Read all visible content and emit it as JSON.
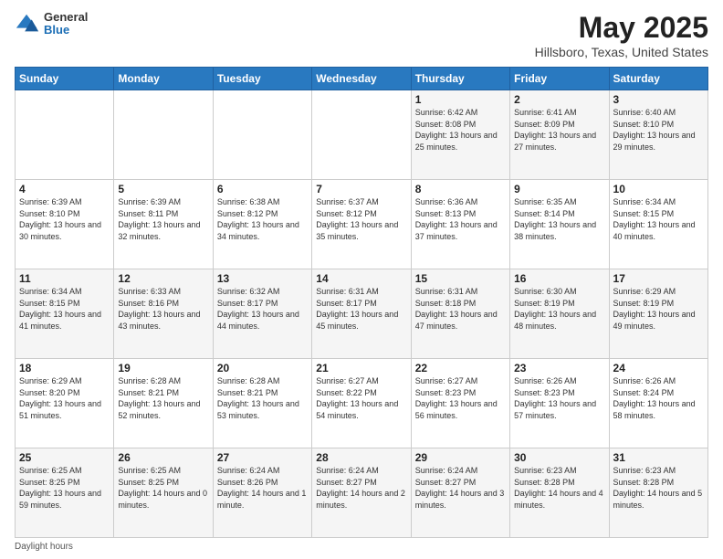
{
  "logo": {
    "general": "General",
    "blue": "Blue"
  },
  "header": {
    "title": "May 2025",
    "subtitle": "Hillsboro, Texas, United States"
  },
  "weekdays": [
    "Sunday",
    "Monday",
    "Tuesday",
    "Wednesday",
    "Thursday",
    "Friday",
    "Saturday"
  ],
  "weeks": [
    [
      {
        "day": "",
        "info": ""
      },
      {
        "day": "",
        "info": ""
      },
      {
        "day": "",
        "info": ""
      },
      {
        "day": "",
        "info": ""
      },
      {
        "day": "1",
        "info": "Sunrise: 6:42 AM\nSunset: 8:08 PM\nDaylight: 13 hours and 25 minutes."
      },
      {
        "day": "2",
        "info": "Sunrise: 6:41 AM\nSunset: 8:09 PM\nDaylight: 13 hours and 27 minutes."
      },
      {
        "day": "3",
        "info": "Sunrise: 6:40 AM\nSunset: 8:10 PM\nDaylight: 13 hours and 29 minutes."
      }
    ],
    [
      {
        "day": "4",
        "info": "Sunrise: 6:39 AM\nSunset: 8:10 PM\nDaylight: 13 hours and 30 minutes."
      },
      {
        "day": "5",
        "info": "Sunrise: 6:39 AM\nSunset: 8:11 PM\nDaylight: 13 hours and 32 minutes."
      },
      {
        "day": "6",
        "info": "Sunrise: 6:38 AM\nSunset: 8:12 PM\nDaylight: 13 hours and 34 minutes."
      },
      {
        "day": "7",
        "info": "Sunrise: 6:37 AM\nSunset: 8:12 PM\nDaylight: 13 hours and 35 minutes."
      },
      {
        "day": "8",
        "info": "Sunrise: 6:36 AM\nSunset: 8:13 PM\nDaylight: 13 hours and 37 minutes."
      },
      {
        "day": "9",
        "info": "Sunrise: 6:35 AM\nSunset: 8:14 PM\nDaylight: 13 hours and 38 minutes."
      },
      {
        "day": "10",
        "info": "Sunrise: 6:34 AM\nSunset: 8:15 PM\nDaylight: 13 hours and 40 minutes."
      }
    ],
    [
      {
        "day": "11",
        "info": "Sunrise: 6:34 AM\nSunset: 8:15 PM\nDaylight: 13 hours and 41 minutes."
      },
      {
        "day": "12",
        "info": "Sunrise: 6:33 AM\nSunset: 8:16 PM\nDaylight: 13 hours and 43 minutes."
      },
      {
        "day": "13",
        "info": "Sunrise: 6:32 AM\nSunset: 8:17 PM\nDaylight: 13 hours and 44 minutes."
      },
      {
        "day": "14",
        "info": "Sunrise: 6:31 AM\nSunset: 8:17 PM\nDaylight: 13 hours and 45 minutes."
      },
      {
        "day": "15",
        "info": "Sunrise: 6:31 AM\nSunset: 8:18 PM\nDaylight: 13 hours and 47 minutes."
      },
      {
        "day": "16",
        "info": "Sunrise: 6:30 AM\nSunset: 8:19 PM\nDaylight: 13 hours and 48 minutes."
      },
      {
        "day": "17",
        "info": "Sunrise: 6:29 AM\nSunset: 8:19 PM\nDaylight: 13 hours and 49 minutes."
      }
    ],
    [
      {
        "day": "18",
        "info": "Sunrise: 6:29 AM\nSunset: 8:20 PM\nDaylight: 13 hours and 51 minutes."
      },
      {
        "day": "19",
        "info": "Sunrise: 6:28 AM\nSunset: 8:21 PM\nDaylight: 13 hours and 52 minutes."
      },
      {
        "day": "20",
        "info": "Sunrise: 6:28 AM\nSunset: 8:21 PM\nDaylight: 13 hours and 53 minutes."
      },
      {
        "day": "21",
        "info": "Sunrise: 6:27 AM\nSunset: 8:22 PM\nDaylight: 13 hours and 54 minutes."
      },
      {
        "day": "22",
        "info": "Sunrise: 6:27 AM\nSunset: 8:23 PM\nDaylight: 13 hours and 56 minutes."
      },
      {
        "day": "23",
        "info": "Sunrise: 6:26 AM\nSunset: 8:23 PM\nDaylight: 13 hours and 57 minutes."
      },
      {
        "day": "24",
        "info": "Sunrise: 6:26 AM\nSunset: 8:24 PM\nDaylight: 13 hours and 58 minutes."
      }
    ],
    [
      {
        "day": "25",
        "info": "Sunrise: 6:25 AM\nSunset: 8:25 PM\nDaylight: 13 hours and 59 minutes."
      },
      {
        "day": "26",
        "info": "Sunrise: 6:25 AM\nSunset: 8:25 PM\nDaylight: 14 hours and 0 minutes."
      },
      {
        "day": "27",
        "info": "Sunrise: 6:24 AM\nSunset: 8:26 PM\nDaylight: 14 hours and 1 minute."
      },
      {
        "day": "28",
        "info": "Sunrise: 6:24 AM\nSunset: 8:27 PM\nDaylight: 14 hours and 2 minutes."
      },
      {
        "day": "29",
        "info": "Sunrise: 6:24 AM\nSunset: 8:27 PM\nDaylight: 14 hours and 3 minutes."
      },
      {
        "day": "30",
        "info": "Sunrise: 6:23 AM\nSunset: 8:28 PM\nDaylight: 14 hours and 4 minutes."
      },
      {
        "day": "31",
        "info": "Sunrise: 6:23 AM\nSunset: 8:28 PM\nDaylight: 14 hours and 5 minutes."
      }
    ]
  ],
  "footer": {
    "daylight_label": "Daylight hours"
  }
}
